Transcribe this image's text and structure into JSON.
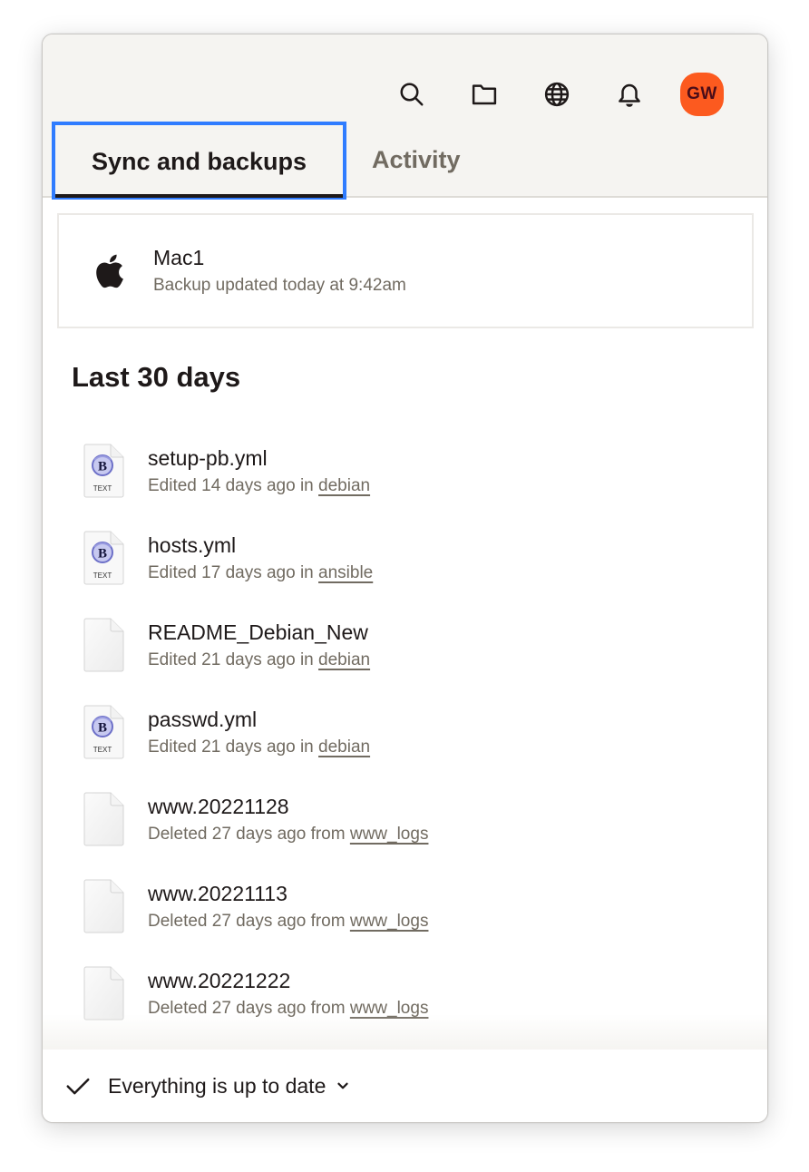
{
  "toolbar": {
    "icons": [
      "search-icon",
      "folder-icon",
      "globe-icon",
      "bell-icon"
    ],
    "avatar_initials": "GW",
    "avatar_color": "#fc5a1f"
  },
  "tabs": [
    {
      "label": "Sync and backups",
      "active": true
    },
    {
      "label": "Activity",
      "active": false
    }
  ],
  "device": {
    "icon": "apple-icon",
    "name": "Mac1",
    "status": "Backup updated today at 9:42am"
  },
  "section_title": "Last 30 days",
  "files": [
    {
      "name": "setup-pb.yml",
      "icon": "bbedit-text-icon",
      "action": "Edited 14 days ago in ",
      "folder": "debian"
    },
    {
      "name": "hosts.yml",
      "icon": "bbedit-text-icon",
      "action": "Edited 17 days ago in ",
      "folder": "ansible"
    },
    {
      "name": "README_Debian_New",
      "icon": "blank-file-icon",
      "action": "Edited 21 days ago in ",
      "folder": "debian"
    },
    {
      "name": "passwd.yml",
      "icon": "bbedit-text-icon",
      "action": "Edited 21 days ago in ",
      "folder": "debian"
    },
    {
      "name": "www.20221128",
      "icon": "blank-file-icon",
      "action": "Deleted 27 days ago from ",
      "folder": "www_logs"
    },
    {
      "name": "www.20221113",
      "icon": "blank-file-icon",
      "action": "Deleted 27 days ago from ",
      "folder": "www_logs"
    },
    {
      "name": "www.20221222",
      "icon": "blank-file-icon",
      "action": "Deleted 27 days ago from ",
      "folder": "www_logs"
    }
  ],
  "footer": {
    "status": "Everything is up to date",
    "icon": "checkmark-icon"
  },
  "colors": {
    "accent_focus": "#2f7cff",
    "header_bg": "#f5f4f1",
    "text_primary": "#1e1919",
    "text_secondary": "#716b61"
  }
}
